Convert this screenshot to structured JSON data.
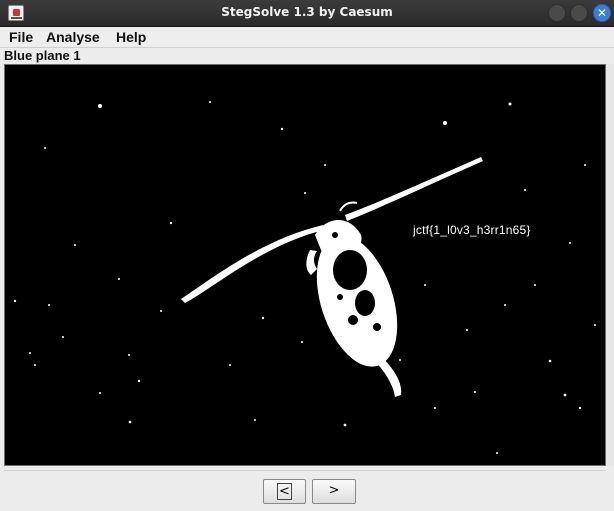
{
  "window": {
    "title": "StegSolve 1.3 by Caesum",
    "close_glyph": "✕"
  },
  "menu": {
    "file": "File",
    "analyse": "Analyse",
    "help": "Help"
  },
  "panel": {
    "plane_label": "Blue plane 1"
  },
  "image": {
    "flag_text": "jctf{1_l0v3_h3rr1n65}"
  },
  "navigation": {
    "prev_label": "<",
    "next_label": ">"
  },
  "colors": {
    "titlebar": "#2e2e2e",
    "close_button": "#3b7dd8",
    "canvas": "#000000"
  }
}
